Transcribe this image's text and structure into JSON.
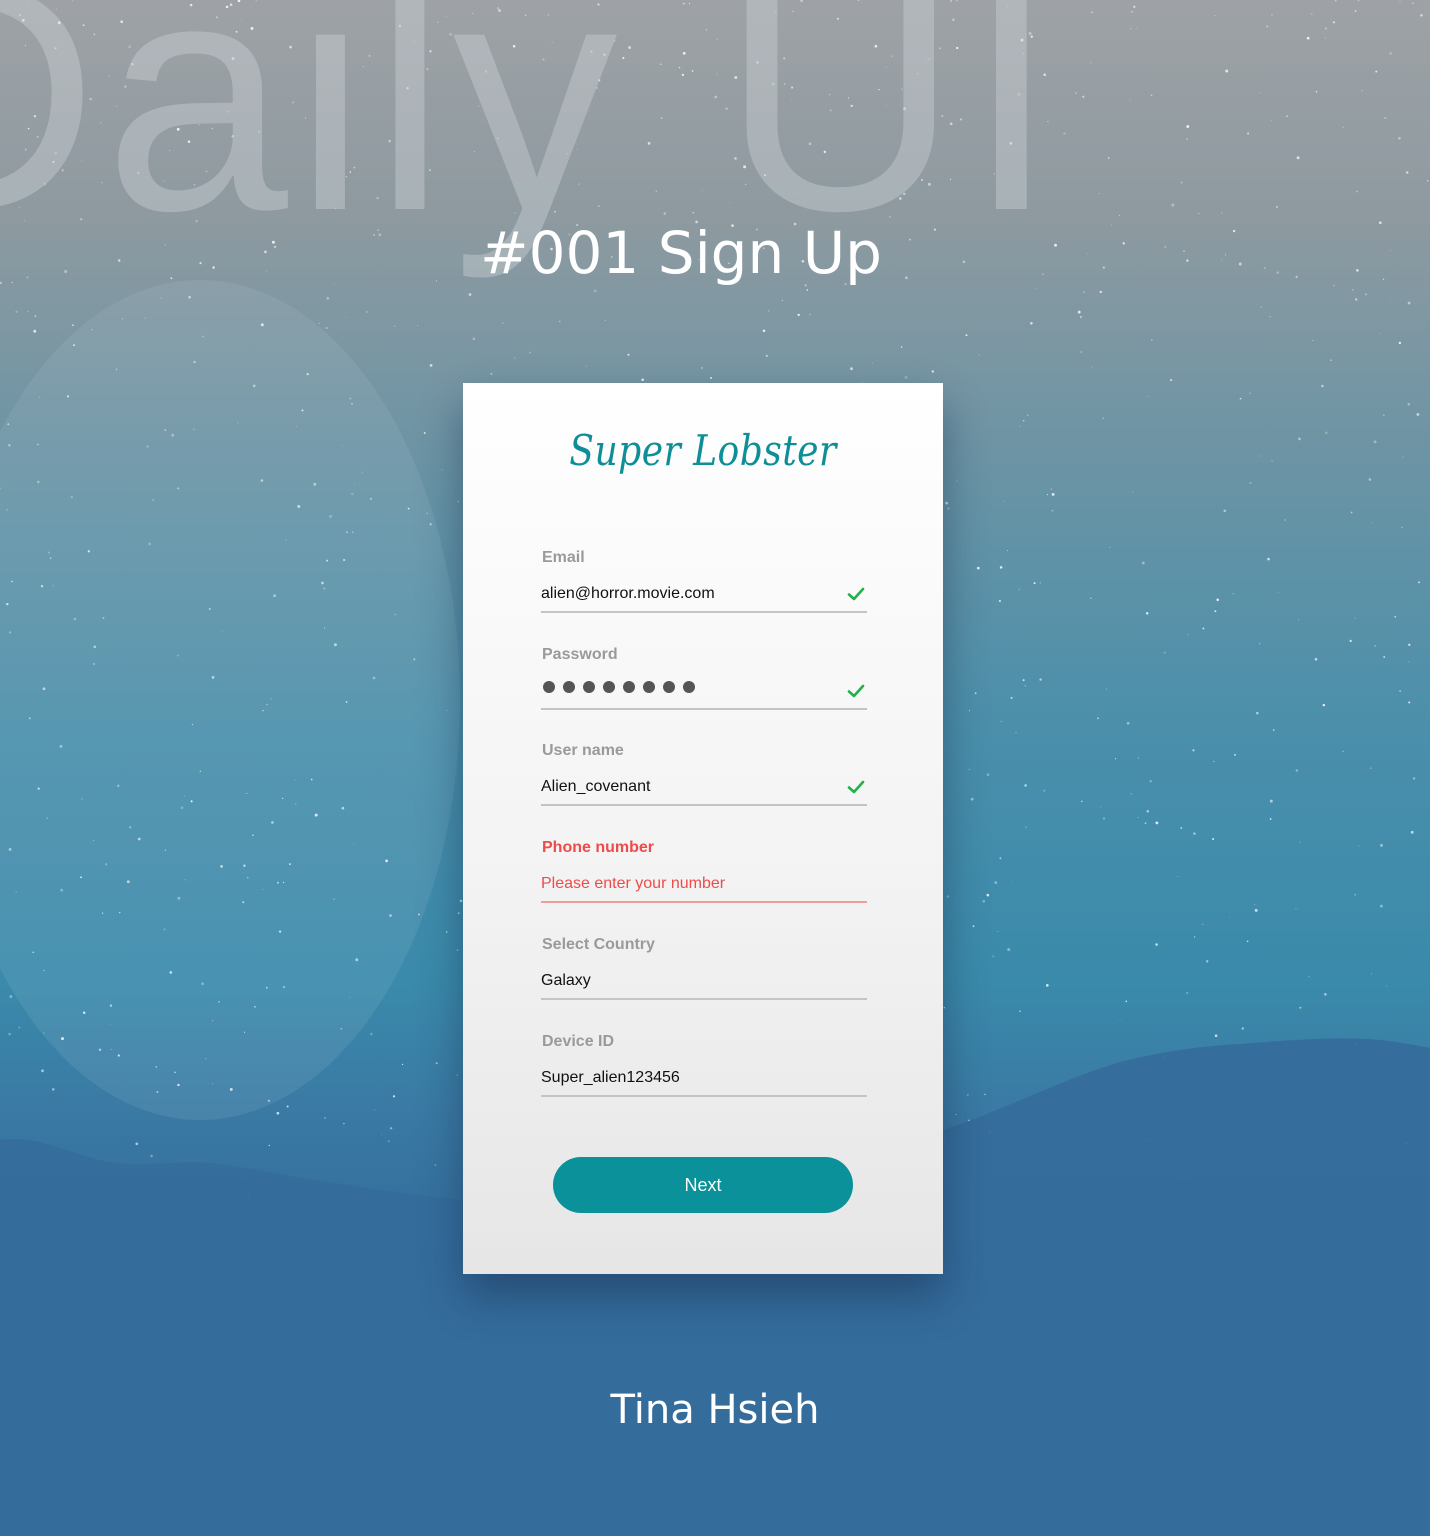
{
  "background": {
    "watermark": "Daily UI"
  },
  "header": {
    "title": "#001 Sign Up"
  },
  "card": {
    "brand": "Super Lobster",
    "fields": [
      {
        "label": "Email",
        "value": "alien@horror.movie.com",
        "valid": true
      },
      {
        "label": "Password",
        "masked_length": 8,
        "valid": true
      },
      {
        "label": "User name",
        "value": "Alien_covenant",
        "valid": true
      },
      {
        "label": "Phone number",
        "placeholder": "Please enter your number",
        "error": true
      },
      {
        "label": "Select Country",
        "value": "Galaxy"
      },
      {
        "label": "Device ID",
        "value": "Super_alien123456"
      }
    ],
    "next_label": "Next"
  },
  "footer": {
    "author": "Tina Hsieh"
  },
  "colors": {
    "accent": "#0a919a",
    "error": "#ef4b4b",
    "success": "#22b04b",
    "label": "#9a9a9a"
  },
  "icons": {
    "valid": "check-icon"
  }
}
